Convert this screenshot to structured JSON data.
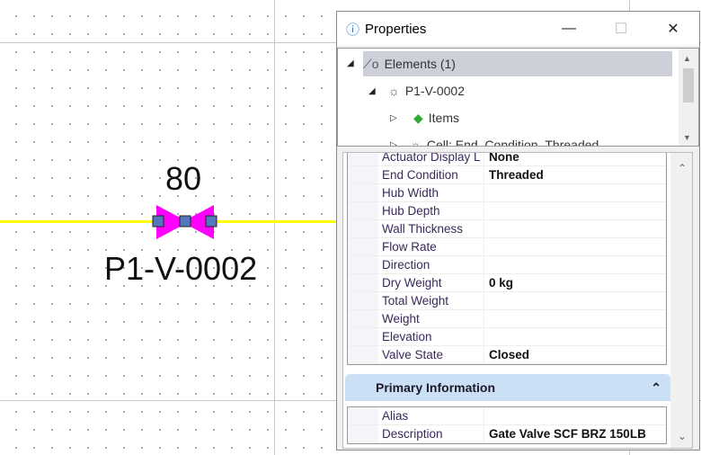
{
  "canvas": {
    "dimension_label": "80",
    "valve_tag": "P1-V-0002",
    "pipe_color": "#ffff00",
    "valve_color": "#ff00ff"
  },
  "window": {
    "title": "Properties",
    "minimize": "—",
    "maximize": "☐",
    "close": "✕"
  },
  "tree": {
    "items": [
      {
        "label": "Elements (1)",
        "toggle": "◢"
      },
      {
        "label": "P1-V-0002",
        "toggle": "◢"
      },
      {
        "label": "Items",
        "toggle": "▷"
      },
      {
        "label": "Cell: End_Condition_Threaded",
        "toggle": "▷"
      }
    ]
  },
  "properties": {
    "rows": [
      {
        "label": "Actuator Display L",
        "value": "None"
      },
      {
        "label": "End Condition",
        "value": "Threaded"
      },
      {
        "label": "Hub Width",
        "value": ""
      },
      {
        "label": "Hub Depth",
        "value": ""
      },
      {
        "label": "Wall Thickness",
        "value": ""
      },
      {
        "label": "Flow Rate",
        "value": ""
      },
      {
        "label": "Direction",
        "value": ""
      },
      {
        "label": "Dry Weight",
        "value": "0 kg"
      },
      {
        "label": "Total Weight",
        "value": ""
      },
      {
        "label": "Weight",
        "value": ""
      },
      {
        "label": "Elevation",
        "value": ""
      },
      {
        "label": "Valve State",
        "value": "Closed"
      }
    ],
    "group": {
      "title": "Primary Information",
      "rows": [
        {
          "label": "Alias",
          "value": ""
        },
        {
          "label": "Description",
          "value": "Gate Valve SCF BRZ 150LB"
        }
      ]
    }
  }
}
